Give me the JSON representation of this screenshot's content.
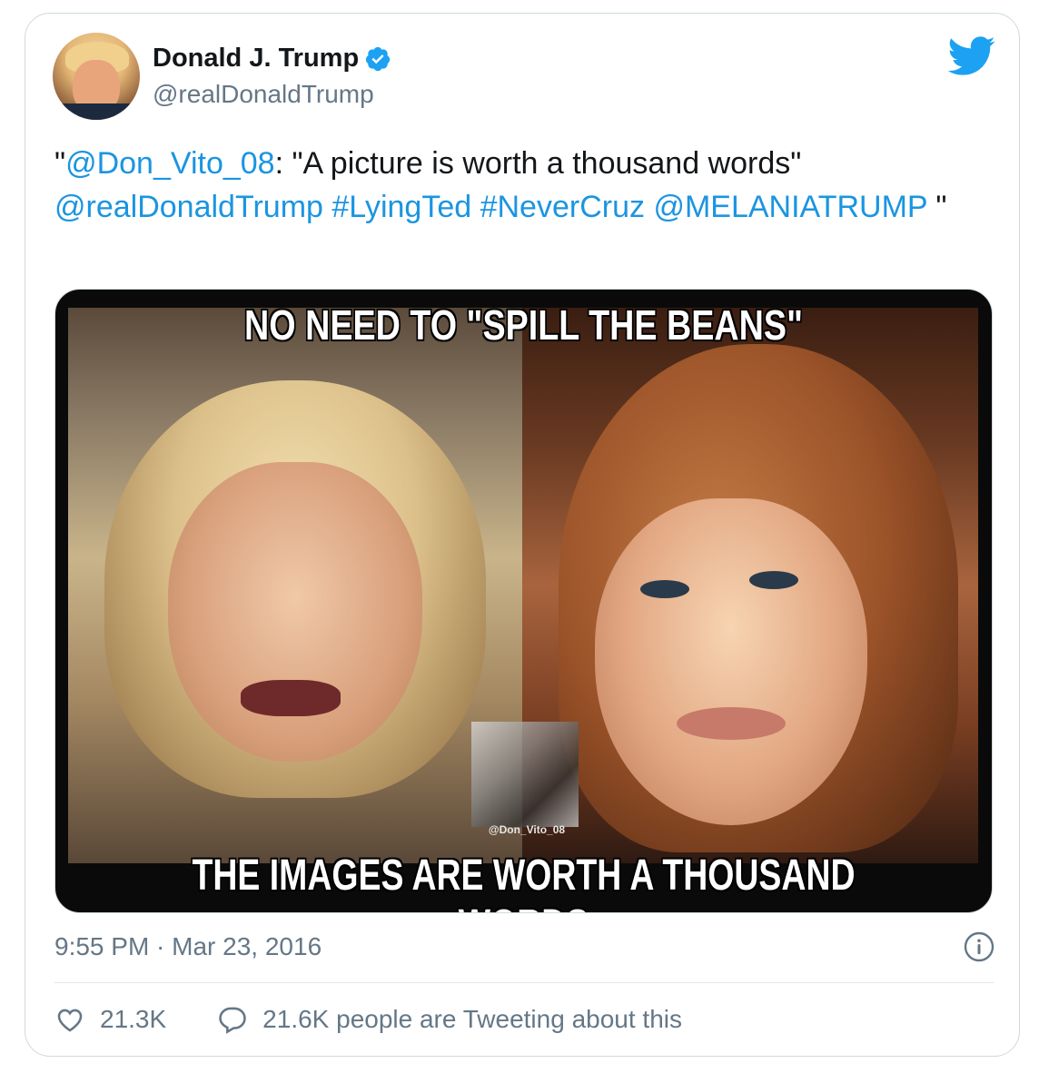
{
  "author": {
    "name": "Donald J. Trump",
    "handle": "@realDonaldTrump",
    "verified": true
  },
  "tweet": {
    "text_parts": [
      {
        "text": "\"",
        "link": false
      },
      {
        "text": "@Don_Vito_08",
        "link": true
      },
      {
        "text": ": \"A picture is worth a thousand words\" ",
        "link": false
      },
      {
        "text": "@realDonaldTrump",
        "link": true
      },
      {
        "text": "  ",
        "link": false
      },
      {
        "text": "#LyingTed",
        "link": true
      },
      {
        "text": " ",
        "link": false
      },
      {
        "text": "#NeverCruz",
        "link": true
      },
      {
        "text": " ",
        "link": false
      },
      {
        "text": "@MELANIATRUMP",
        "link": true
      },
      {
        "text": " \"",
        "link": false
      }
    ]
  },
  "media": {
    "top_caption": "NO NEED TO \"SPILL THE BEANS\"",
    "bottom_caption": "THE IMAGES ARE WORTH A THOUSAND WORDS",
    "watermark": "@Don_Vito_08"
  },
  "meta": {
    "timestamp": "9:55 PM · Mar 23, 2016"
  },
  "actions": {
    "likes": "21.3K",
    "tweeting": "21.6K people are Tweeting about this"
  },
  "colors": {
    "link": "#1b95e0",
    "twitter_blue": "#1da1f2",
    "secondary_text": "#657786"
  },
  "icons": [
    "twitter-bird-icon",
    "verified-badge-icon",
    "info-icon",
    "heart-icon",
    "reply-bubble-icon"
  ]
}
